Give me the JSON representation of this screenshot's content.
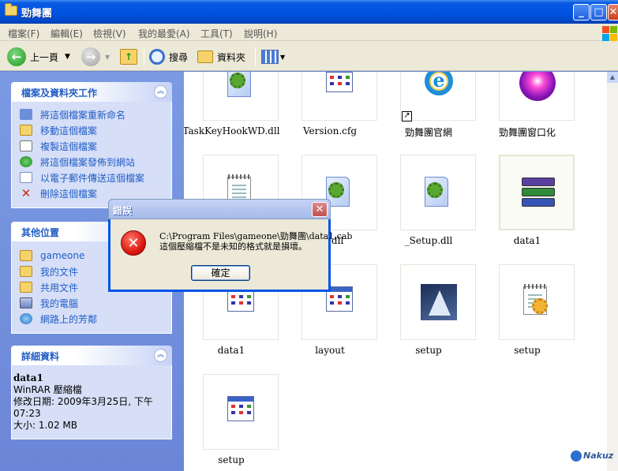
{
  "window": {
    "title": "勁舞團"
  },
  "menu": [
    "檔案(F)",
    "編輯(E)",
    "檢視(V)",
    "我的最愛(A)",
    "工具(T)",
    "說明(H)"
  ],
  "toolbar": {
    "back": "上一頁",
    "search": "搜尋",
    "folders": "資料夾"
  },
  "panels": {
    "tasks": {
      "title": "檔案及資料夾工作",
      "items": [
        "將這個檔案重新命名",
        "移動這個檔案",
        "複製這個檔案",
        "將這個檔案發佈到網站",
        "以電子郵件傳送這個檔案",
        "刪除這個檔案"
      ]
    },
    "places": {
      "title": "其他位置",
      "items": [
        "gameone",
        "我的文件",
        "共用文件",
        "我的電腦",
        "網路上的芳鄰"
      ]
    },
    "details": {
      "title": "詳細資料",
      "name": "data1",
      "type": "WinRAR 壓縮檔",
      "modified_line1": "修改日期: 2009年3月25日, 下午",
      "modified_line2": "07:23",
      "size": "大小: 1.02 MB"
    }
  },
  "files": [
    "TaskKeyHookWD.dll",
    "Version.cfg",
    "勁舞團官網",
    "勁舞團窗口化",
    "",
    "up.dll",
    "_Setup.dll",
    "data1",
    "data1",
    "layout",
    "setup",
    "setup",
    "setup"
  ],
  "dialog": {
    "title": "錯誤",
    "line1": "C:\\Program Files\\gameone\\勁舞團\\data1.cab",
    "line2": "這個壓縮檔不是未知的格式就是損壞。",
    "ok": "確定"
  },
  "watermark": "Nakuz"
}
